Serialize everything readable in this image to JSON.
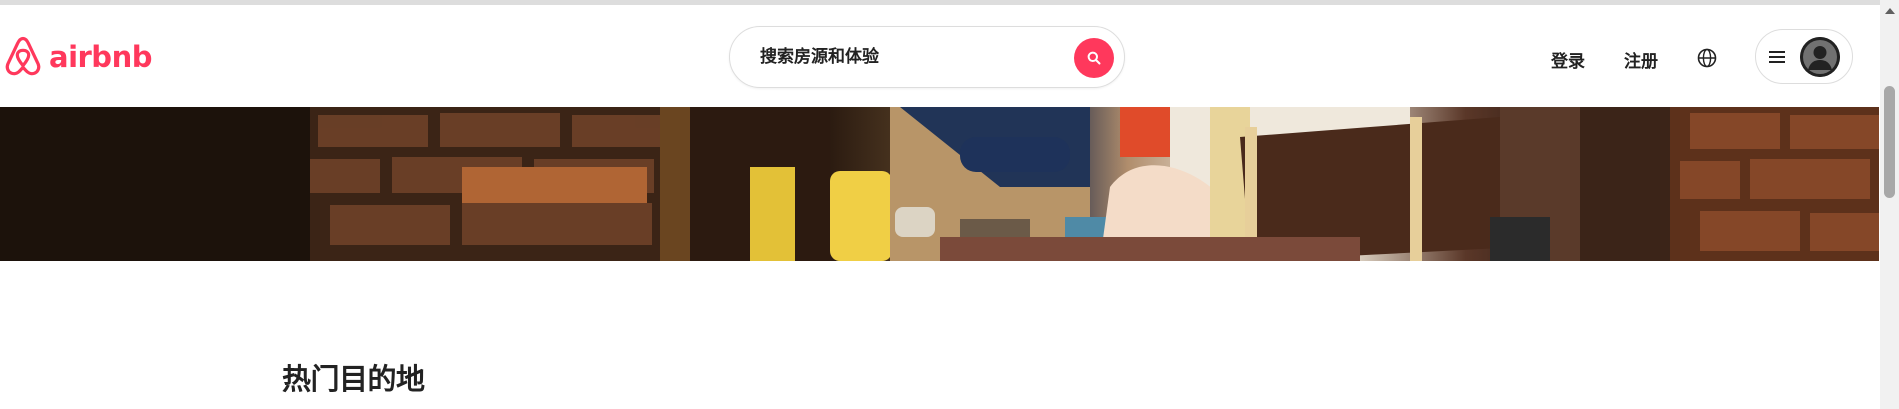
{
  "brand": {
    "name": "airbnb",
    "color": "#ff385c",
    "logo_icon": "airbnb-belo-icon"
  },
  "search": {
    "placeholder": "搜索房源和体验",
    "button_icon": "search-icon",
    "button_color": "#ff385c"
  },
  "nav": {
    "login_label": "登录",
    "signup_label": "注册",
    "language_icon": "globe-icon",
    "menu_icon": "hamburger-icon",
    "avatar_icon": "user-avatar-icon"
  },
  "hero": {
    "description_icon": "hero-banner-image"
  },
  "main": {
    "section_title": "热门目的地"
  }
}
